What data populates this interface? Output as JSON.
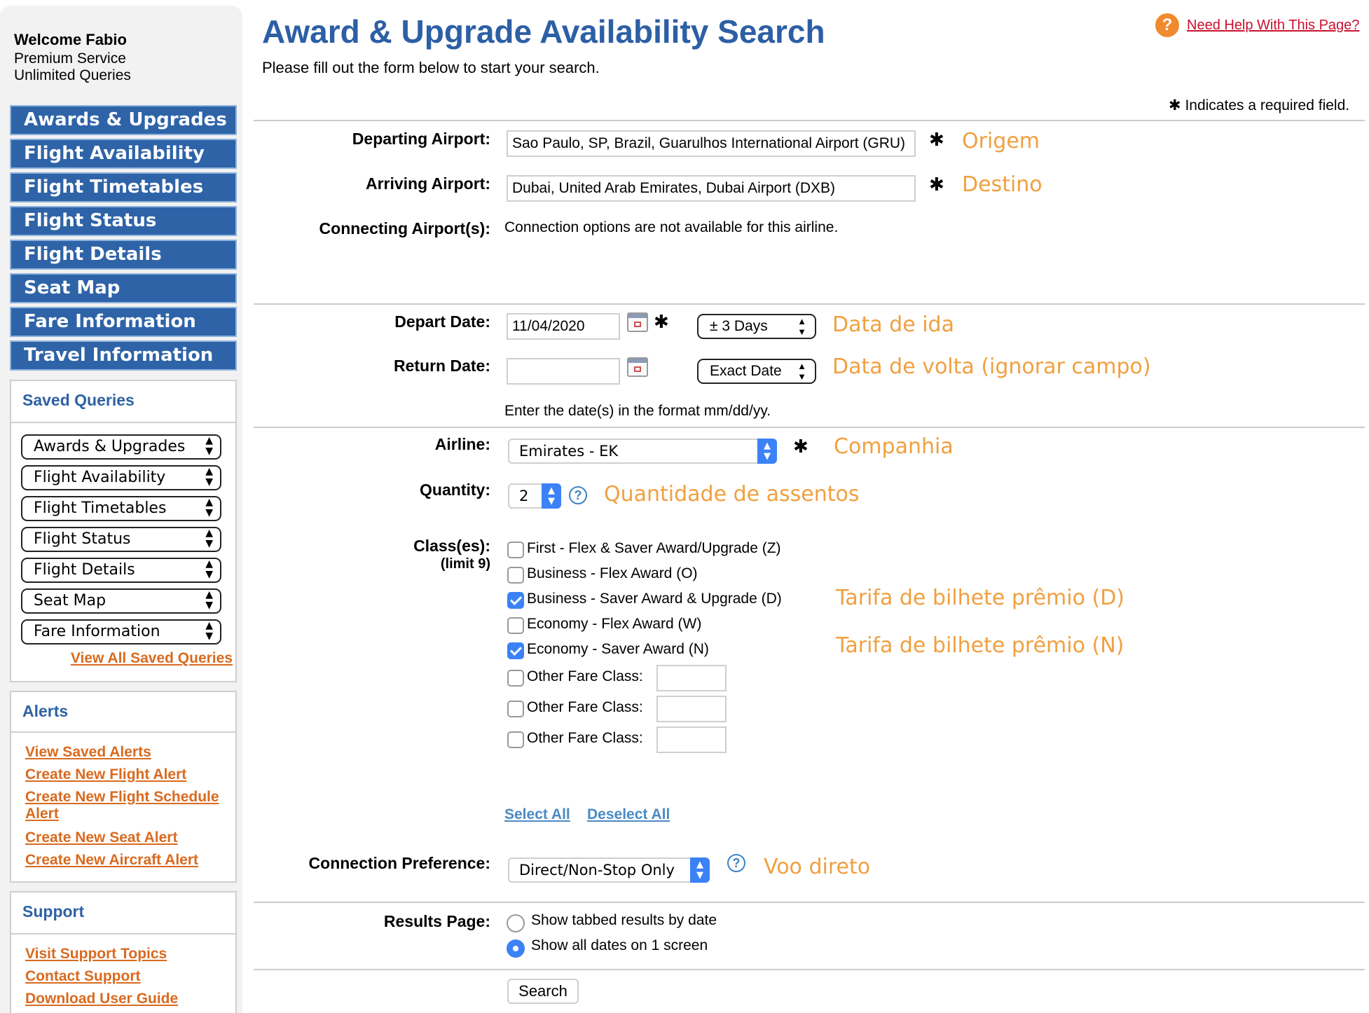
{
  "user": {
    "welcome": "Welcome Fabio",
    "plan_line1": "Premium Service",
    "plan_line2": "Unlimited Queries"
  },
  "nav": [
    "Awards & Upgrades",
    "Flight Availability",
    "Flight Timetables",
    "Flight Status",
    "Flight Details",
    "Seat Map",
    "Fare Information",
    "Travel Information"
  ],
  "saved_queries": {
    "title": "Saved Queries",
    "selects": [
      "Awards & Upgrades",
      "Flight Availability",
      "Flight Timetables",
      "Flight Status",
      "Flight Details",
      "Seat Map",
      "Fare Information"
    ],
    "view_all": "View All Saved Queries"
  },
  "alerts": {
    "title": "Alerts",
    "links": [
      "View Saved Alerts",
      "Create New Flight Alert",
      "Create New Flight Schedule",
      "Alert",
      "Create New Seat Alert",
      "Create New Aircraft Alert"
    ]
  },
  "support": {
    "title": "Support",
    "links": [
      "Visit Support Topics",
      "Contact Support",
      "Download User Guide"
    ]
  },
  "page": {
    "title": "Award & Upgrade Availability Search",
    "subtitle": "Please fill out the form below to start your search.",
    "help_link": "Need Help With This Page?",
    "required_note": "Indicates a required field.",
    "star": "✱"
  },
  "form": {
    "departing": {
      "label": "Departing Airport:",
      "value": "Sao Paulo, SP, Brazil, Guarulhos International Airport (GRU)",
      "note": "Origem"
    },
    "arriving": {
      "label": "Arriving Airport:",
      "value": "Dubai, United Arab Emirates, Dubai Airport (DXB)",
      "note": "Destino"
    },
    "connecting": {
      "label": "Connecting Airport(s):",
      "value": "Connection options are not available for this airline."
    },
    "depart_date": {
      "label": "Depart Date:",
      "value": "11/04/2020",
      "range": "± 3 Days",
      "note": "Data de ida"
    },
    "return_date": {
      "label": "Return Date:",
      "value": "",
      "range": "Exact Date",
      "note": "Data de volta (ignorar campo)"
    },
    "date_hint": "Enter the date(s) in the format mm/dd/yy.",
    "airline": {
      "label": "Airline:",
      "value": "Emirates - EK",
      "note": "Companhia"
    },
    "quantity": {
      "label": "Quantity:",
      "value": "2",
      "note": "Quantidade de assentos"
    },
    "classes": {
      "label": "Class(es):",
      "limit": "(limit 9)",
      "options": [
        {
          "label": "First - Flex & Saver Award/Upgrade (Z)",
          "checked": false,
          "note": ""
        },
        {
          "label": "Business - Flex Award (O)",
          "checked": false,
          "note": ""
        },
        {
          "label": "Business - Saver Award & Upgrade (D)",
          "checked": true,
          "note": "Tarifa de bilhete prêmio (D)"
        },
        {
          "label": "Economy - Flex Award (W)",
          "checked": false,
          "note": ""
        },
        {
          "label": "Economy - Saver Award (N)",
          "checked": true,
          "note": "Tarifa de bilhete prêmio (N)"
        }
      ],
      "other_label": "Other Fare Class:",
      "select_all": "Select All",
      "deselect_all": "Deselect All"
    },
    "connection_pref": {
      "label": "Connection Preference:",
      "value": "Direct/Non-Stop Only",
      "note": "Voo direto"
    },
    "results_page": {
      "label": "Results Page:",
      "options": [
        {
          "label": "Show tabbed results by date",
          "selected": false
        },
        {
          "label": "Show all dates on 1 screen",
          "selected": true
        }
      ]
    },
    "search_button": "Search"
  }
}
